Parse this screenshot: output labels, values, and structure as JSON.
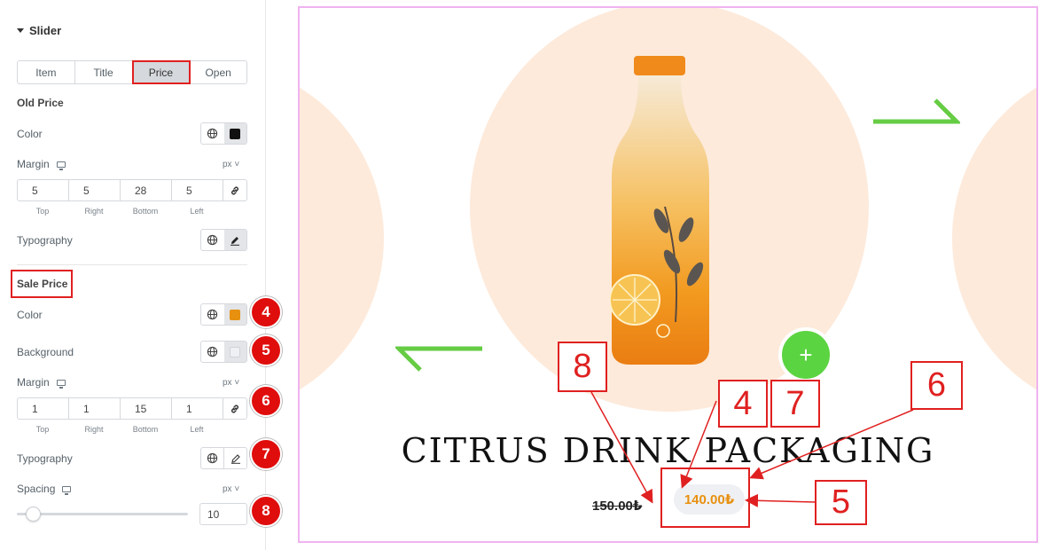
{
  "panel": {
    "section_title": "Slider",
    "tabs": [
      {
        "label": "Item"
      },
      {
        "label": "Title"
      },
      {
        "label": "Price"
      },
      {
        "label": "Open"
      }
    ],
    "old_price": {
      "heading": "Old Price",
      "color_label": "Color",
      "color_value": "#111111",
      "margin_label": "Margin",
      "unit": "px",
      "margin": {
        "top": "5",
        "right": "5",
        "bottom": "28",
        "left": "5"
      },
      "typography_label": "Typography"
    },
    "dim_labels": {
      "top": "Top",
      "right": "Right",
      "bottom": "Bottom",
      "left": "Left"
    },
    "sale_price": {
      "heading": "Sale Price",
      "color_label": "Color",
      "color_value": "#e8900f",
      "background_label": "Background",
      "background_value": "#eef0f3",
      "margin_label": "Margin",
      "unit": "px",
      "margin": {
        "top": "1",
        "right": "1",
        "bottom": "15",
        "left": "1"
      },
      "typography_label": "Typography",
      "spacing_label": "Spacing",
      "spacing_value": "10"
    },
    "badges": [
      "4",
      "5",
      "6",
      "7",
      "8"
    ]
  },
  "preview": {
    "title": "CITRUS DRINK PACKAGING",
    "old_price": "150.00₺",
    "sale_price": "140.00₺",
    "plus": "+",
    "callouts": [
      "8",
      "4",
      "7",
      "6",
      "5"
    ],
    "accent_green": "#5bd441",
    "annotation_red": "#e02020"
  }
}
